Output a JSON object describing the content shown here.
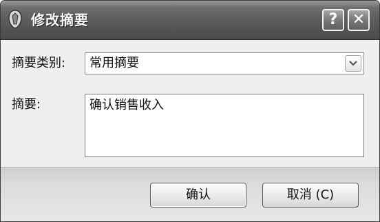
{
  "window": {
    "title": "修改摘要",
    "help_label": "?",
    "close_label": "✕"
  },
  "form": {
    "category_label": "摘要类别:",
    "category_value": "常用摘要",
    "summary_label": "摘要:",
    "summary_value": "确认销售收入"
  },
  "buttons": {
    "ok_label": "确认",
    "cancel_label": "取消 (C)"
  }
}
